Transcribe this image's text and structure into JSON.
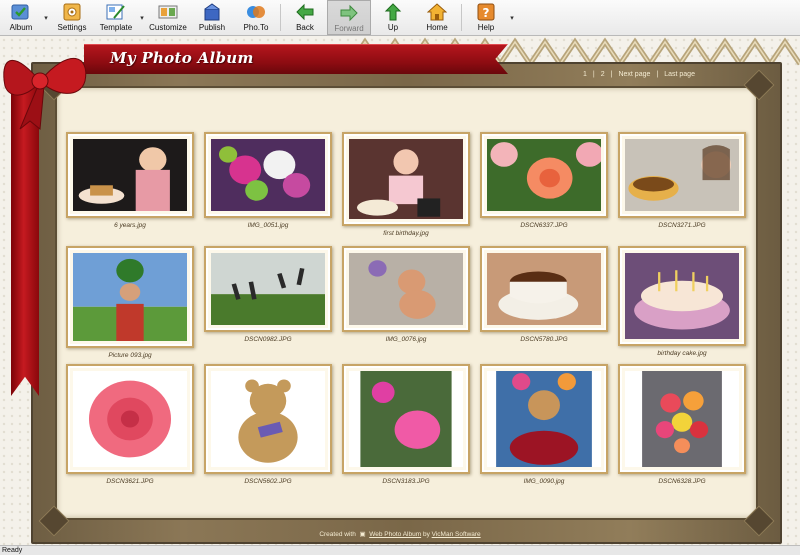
{
  "toolbar": {
    "album": "Album",
    "settings": "Settings",
    "template": "Template",
    "customize": "Customize",
    "publish": "Publish",
    "phoTo": "Pho.To",
    "back": "Back",
    "forward": "Forward",
    "up": "Up",
    "home": "Home",
    "help": "Help"
  },
  "album": {
    "title": "My Photo Album",
    "pager": {
      "p1": "1",
      "p2": "2",
      "sep": "|",
      "next": "Next page",
      "last": "Last page"
    }
  },
  "photos": [
    {
      "caption": "6 years.jpg",
      "subject": "child-with-cake"
    },
    {
      "caption": "IMG_0051.jpg",
      "subject": "flower-bouquet"
    },
    {
      "caption": "first birthday.jpg",
      "subject": "baby-birthday"
    },
    {
      "caption": "DSCN6337.JPG",
      "subject": "orange-rose"
    },
    {
      "caption": "DSCN3271.JPG",
      "subject": "girl-and-cake"
    },
    {
      "caption": "Picture 093.jpg",
      "subject": "man-with-watermelon"
    },
    {
      "caption": "DSCN0982.JPG",
      "subject": "people-jumping"
    },
    {
      "caption": "IMG_0076.jpg",
      "subject": "teddy-bear-toy"
    },
    {
      "caption": "DSCN5780.JPG",
      "subject": "tea-cup"
    },
    {
      "caption": "birthday cake.jpg",
      "subject": "birthday-cake"
    },
    {
      "caption": "DSCN3621.JPG",
      "subject": "pink-rose"
    },
    {
      "caption": "DSCN5602.JPG",
      "subject": "teddy-bear"
    },
    {
      "caption": "DSCN3183.JPG",
      "subject": "pink-tulip"
    },
    {
      "caption": "IMG_0090.jpg",
      "subject": "teddy-with-roses"
    },
    {
      "caption": "DSCN6328.JPG",
      "subject": "rose-bouquet"
    }
  ],
  "footer": {
    "prefix": "Created with",
    "link": "Web Photo Album",
    "by": "by",
    "company": "VicMan Software"
  },
  "status": "Ready",
  "colors": {
    "ribbon": "#b5161d",
    "frame": "#7a6748",
    "paper": "#f6efdc"
  }
}
